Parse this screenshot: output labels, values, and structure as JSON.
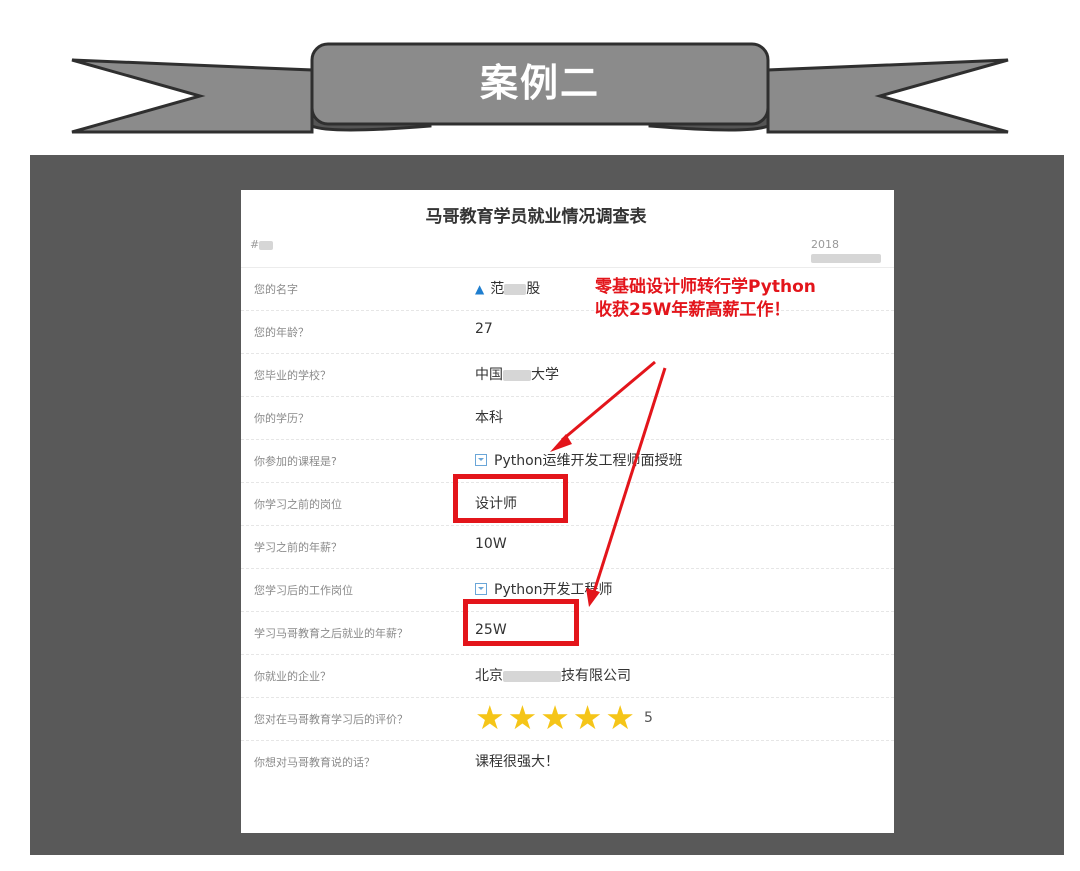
{
  "banner": {
    "title": "案例二"
  },
  "form": {
    "title": "马哥教育学员就业情况调查表",
    "id_prefix": "#",
    "date_prefix": "2018"
  },
  "rows": [
    {
      "question": "您的名字",
      "answer": "范",
      "answer_suffix": "股"
    },
    {
      "question": "您的年龄？",
      "answer": "27"
    },
    {
      "question": "您毕业的学校？",
      "answer": "中国",
      "answer_suffix": "大学"
    },
    {
      "question": "你的学历？",
      "answer": "本科"
    },
    {
      "question": "你参加的课程是?",
      "answer": "Python运维开发工程师面授班"
    },
    {
      "question": "你学习之前的岗位",
      "answer": "设计师"
    },
    {
      "question": "学习之前的年薪？",
      "answer": "10W"
    },
    {
      "question": "您学习后的工作岗位",
      "answer": "Python开发工程师"
    },
    {
      "question": "学习马哥教育之后就业的年薪？",
      "answer": "25W"
    },
    {
      "question": "你就业的企业？",
      "answer": "北京",
      "answer_suffix": "技有限公司"
    },
    {
      "question": "您对在马哥教育学习后的评价？",
      "answer": "5",
      "stars": 5
    },
    {
      "question": "你想对马哥教育说的话？",
      "answer": "课程很强大！"
    }
  ],
  "annotation": {
    "line1": "零基础设计师转行学Python",
    "line2": "收获25W年薪高薪工作！"
  },
  "colors": {
    "highlight": "#e3151b",
    "panel": "#595959",
    "star": "#f5c518",
    "ribbon": "#8b8b8b"
  },
  "icons": {
    "name_field": "user-icon",
    "select_field": "dropdown-icon",
    "rating": "star-icon"
  }
}
